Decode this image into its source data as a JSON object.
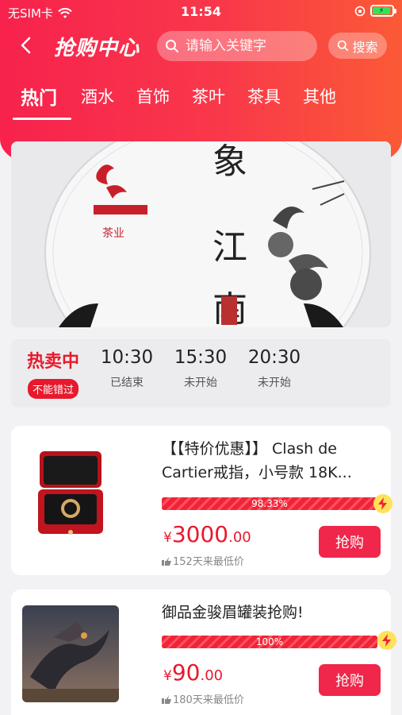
{
  "status_bar": {
    "carrier": "无SIM卡",
    "time": "11:54"
  },
  "header": {
    "title": "抢购中心",
    "search_placeholder": "请输入关键字",
    "search_button": "搜索"
  },
  "tabs": [
    "热门",
    "酒水",
    "首饰",
    "茶叶",
    "茶具",
    "其他"
  ],
  "banner": {
    "brand": "茶业"
  },
  "time_slots": [
    {
      "time": "热卖中",
      "status": "不能错过"
    },
    {
      "time": "10:30",
      "status": "已结束"
    },
    {
      "time": "15:30",
      "status": "未开始"
    },
    {
      "time": "20:30",
      "status": "未开始"
    }
  ],
  "products": [
    {
      "title": "【【特价优惠】】 Clash de Cartier戒指，小号款 18K...",
      "progress_label": "98.33%",
      "progress_value": 0.9833,
      "price_symbol": "¥",
      "price_int": "3000",
      "price_dec": ".00",
      "low_text": "152天来最低价",
      "button": "抢购"
    },
    {
      "title": "御品金骏眉罐装抢购!",
      "progress_label": "100%",
      "progress_value": 1.0,
      "price_symbol": "¥",
      "price_int": "90",
      "price_dec": ".00",
      "low_text": "180天来最低价",
      "button": "抢购"
    }
  ],
  "colors": {
    "accent": "#f0264a",
    "header_start": "#f7224d",
    "header_end": "#fb5a36"
  }
}
